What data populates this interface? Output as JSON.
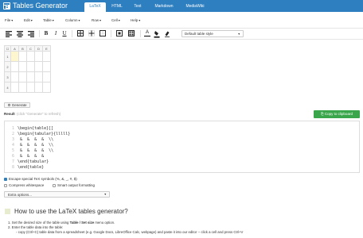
{
  "header": {
    "logo_text": "Tables Generator",
    "tabs": [
      {
        "label": "LaTeX",
        "active": true
      },
      {
        "label": "HTML",
        "active": false
      },
      {
        "label": "Text",
        "active": false
      },
      {
        "label": "Markdown",
        "active": false
      },
      {
        "label": "MediaWiki",
        "active": false
      }
    ],
    "accent_color": "#2e7fc0"
  },
  "menus": [
    "File",
    "Edit",
    "Table",
    "Column",
    "Row",
    "Cell",
    "Help"
  ],
  "toolbar": {
    "icons": [
      "align-left-icon",
      "align-center-icon",
      "align-right-icon",
      "bold-icon",
      "italic-icon",
      "underline-icon",
      "all-borders-icon",
      "inner-borders-icon",
      "outer-borders-icon",
      "merge-cells-icon",
      "split-cells-icon",
      "text-color-icon",
      "fill-color-icon",
      "clear-formatting-icon"
    ],
    "bold": "B",
    "italic": "I",
    "underline": "U",
    "text_color": "A",
    "style_select": "Default table style"
  },
  "grid": {
    "columns": [
      "A",
      "B",
      "C",
      "D",
      "E"
    ],
    "rows": [
      "1",
      "2",
      "3",
      "4"
    ],
    "corner": "☐",
    "selected_color": "#fdf6cf"
  },
  "generate_button": "Generate",
  "result": {
    "label": "Result",
    "hint": "(click \"Generate\" to refresh)",
    "copy_button": "Copy to clipboard",
    "copy_color": "#3aa64b"
  },
  "code_lines": [
    {
      "n": "1",
      "text": "\\begin{table}[]"
    },
    {
      "n": "2",
      "text": "\\begin{tabular}{lllll}"
    },
    {
      "n": "3",
      "text": " &  &  &  &  \\\\"
    },
    {
      "n": "4",
      "text": " &  &  &  &  \\\\"
    },
    {
      "n": "5",
      "text": " &  &  &  &  \\\\"
    },
    {
      "n": "6",
      "text": " &  &  &  &"
    },
    {
      "n": "7",
      "text": "\\end{tabular}"
    },
    {
      "n": "8",
      "text": "\\end{table}"
    }
  ],
  "options": {
    "escape": {
      "label": "Escape special TeX symbols (%, &, _, #, $)",
      "checked": true
    },
    "compress": {
      "label": "Compress whitespace",
      "checked": false
    },
    "smart": {
      "label": "Smart output formatting",
      "checked": false
    },
    "extra": "Extra options..."
  },
  "howto": {
    "title": "How to use the LaTeX tables generator?",
    "step1_pre": "1. Set the desired size of the table using ",
    "step1_bold": "Table / Set size",
    "step1_post": " menu option.",
    "step2": "2. Enter the table data into the table:",
    "step2a": "copy (Ctrl+C) table data from a spreadsheet (e.g. Google Docs, LibreOffice Calc, webpage) and paste it into our editor -- click a cell and press Ctrl+V"
  }
}
